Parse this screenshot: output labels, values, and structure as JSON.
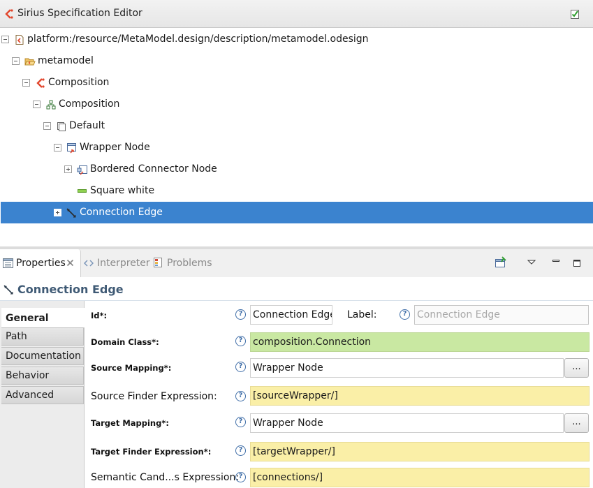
{
  "editor": {
    "title": "Sirius Specification Editor",
    "icon": "sirius-icon",
    "action_icon": "validate-check-icon"
  },
  "tree": {
    "items": [
      {
        "label": "platform:/resource/MetaModel.design/description/metamodel.odesign",
        "toggle": "minus",
        "icon": "odesign-file-icon"
      },
      {
        "label": "metamodel",
        "toggle": "minus",
        "icon": "open-folder-icon"
      },
      {
        "label": "Composition",
        "toggle": "minus",
        "icon": "viewpoint-icon"
      },
      {
        "label": "Composition",
        "toggle": "minus",
        "icon": "diagram-description-icon"
      },
      {
        "label": "Default",
        "toggle": "minus",
        "icon": "layer-icon"
      },
      {
        "label": "Wrapper Node",
        "toggle": "minus",
        "icon": "container-mapping-icon"
      },
      {
        "label": "Bordered Connector Node",
        "toggle": "plus",
        "icon": "bordered-node-icon"
      },
      {
        "label": "Square white",
        "toggle": "none",
        "icon": "square-style-icon"
      },
      {
        "label": "Connection Edge",
        "toggle": "plus",
        "icon": "edge-mapping-icon",
        "selected": true
      }
    ]
  },
  "views": {
    "tabs": [
      {
        "label": "Properties",
        "active": true,
        "closable": true
      },
      {
        "label": "Interpreter",
        "active": false
      },
      {
        "label": "Problems",
        "active": false
      }
    ]
  },
  "properties": {
    "title": "Connection Edge",
    "side_tabs": [
      "General",
      "Path",
      "Documentation",
      "Behavior",
      "Advanced"
    ],
    "active_tab": "General",
    "help_glyph": "?",
    "browse_label": "...",
    "fields": {
      "id": {
        "label": "Id*:",
        "value": "Connection Edge"
      },
      "label": {
        "label": "Label:",
        "placeholder": "Connection Edge"
      },
      "domain_class": {
        "label": "Domain Class*:",
        "value": "composition.Connection"
      },
      "source_mapping": {
        "label": "Source Mapping*:",
        "value": "Wrapper Node"
      },
      "source_finder": {
        "label": "Source Finder Expression:",
        "value": "[sourceWrapper/]"
      },
      "target_mapping": {
        "label": "Target Mapping*:",
        "value": "Wrapper Node"
      },
      "target_finder": {
        "label": "Target Finder Expression*:",
        "value": "[targetWrapper/]"
      },
      "semantic_candidates": {
        "label": "Semantic Cand...s Expression:",
        "value": "[connections/]"
      }
    }
  },
  "colors": {
    "selection": "#3b83cf",
    "required_field": "#c9e8a2",
    "expression_field": "#faefa7",
    "section_title": "#3f5a75"
  }
}
